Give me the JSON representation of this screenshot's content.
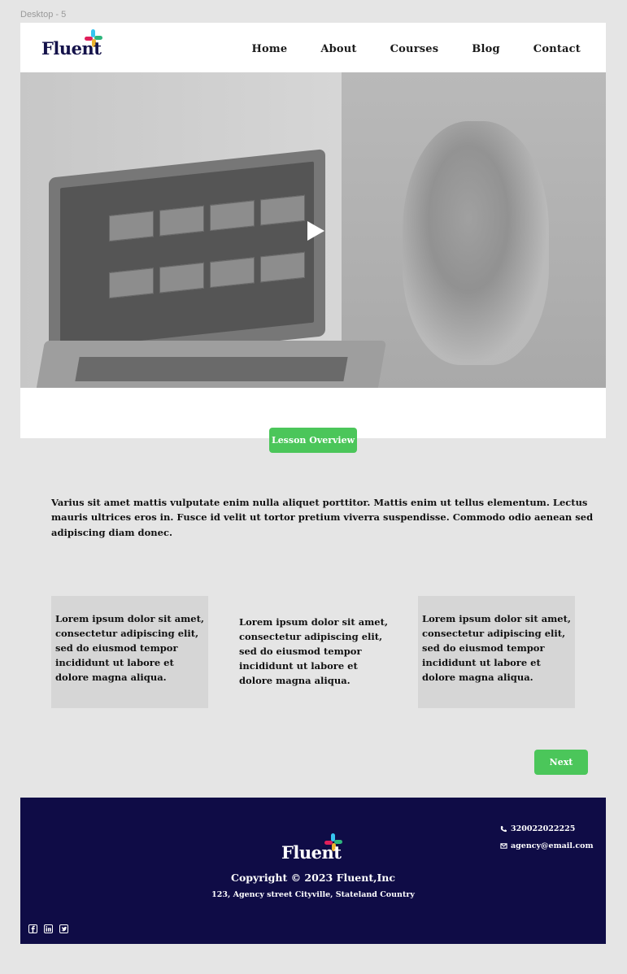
{
  "canvas": {
    "label": "Desktop - 5"
  },
  "brand": {
    "name": "Fluent"
  },
  "nav": {
    "items": [
      "Home",
      "About",
      "Courses",
      "Blog",
      "Contact"
    ]
  },
  "hero": {
    "play_icon": "play-icon"
  },
  "lesson": {
    "overview_button": "Lesson Overview",
    "intro": "Varius sit amet mattis vulputate enim nulla aliquet porttitor. Mattis enim ut tellus elementum. Lectus mauris ultrices eros in. Fusce id velit ut tortor pretium viverra suspendisse. Commodo odio aenean sed adipiscing diam donec.",
    "cards": [
      "Lorem ipsum dolor sit amet, consectetur adipiscing elit, sed do eiusmod tempor incididunt ut labore et dolore magna aliqua.",
      "Lorem ipsum dolor sit amet, consectetur adipiscing elit, sed do eiusmod tempor incididunt ut labore et dolore magna aliqua.",
      "Lorem ipsum dolor sit amet, consectetur adipiscing elit, sed do eiusmod tempor incididunt ut labore et dolore magna aliqua."
    ],
    "next_button": "Next"
  },
  "footer": {
    "brand": "Fluent",
    "copyright": "Copyright © 2023 Fluent,Inc",
    "address": "123, Agency street Cityville, Stateland Country",
    "phone": "320022022225",
    "email": "agency@email.com",
    "phone_icon": "phone-icon",
    "email_icon": "envelope-icon",
    "socials": [
      "facebook-icon",
      "linkedin-icon",
      "twitter-icon"
    ]
  },
  "colors": {
    "accent_green": "#4bc65a",
    "footer_navy": "#0f0c46",
    "logo_navy": "#14124a",
    "background": "#e5e5e5"
  }
}
